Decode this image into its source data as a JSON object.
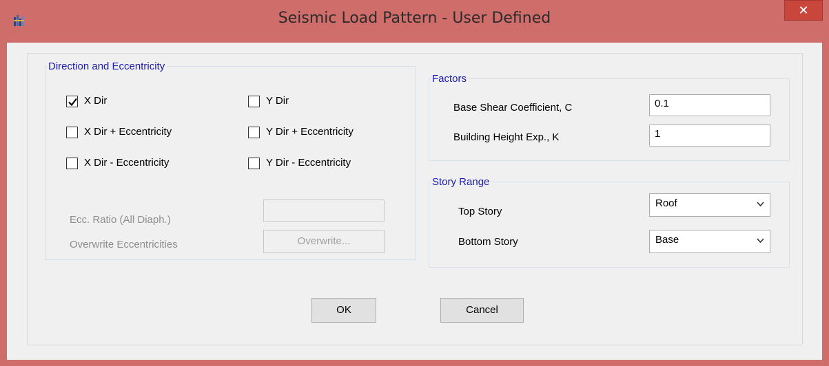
{
  "window": {
    "title": "Seismic Load Pattern - User Defined",
    "close_glyph": "✕",
    "accent": "#cf6d6b"
  },
  "direction_group": {
    "legend": "Direction and Eccentricity",
    "options": [
      {
        "label": "X Dir",
        "checked": true
      },
      {
        "label": "X Dir + Eccentricity",
        "checked": false
      },
      {
        "label": "X Dir - Eccentricity",
        "checked": false
      },
      {
        "label": "Y Dir",
        "checked": false
      },
      {
        "label": "Y Dir + Eccentricity",
        "checked": false
      },
      {
        "label": "Y Dir - Eccentricity",
        "checked": false
      }
    ],
    "ecc_ratio_label": "Ecc. Ratio (All Diaph.)",
    "ecc_ratio_value": "",
    "overwrite_label": "Overwrite Eccentricities",
    "overwrite_button": "Overwrite..."
  },
  "factors_group": {
    "legend": "Factors",
    "base_shear_label": "Base Shear Coefficient, C",
    "base_shear_value": "0.1",
    "height_exp_label": "Building Height Exp., K",
    "height_exp_value": "1"
  },
  "story_group": {
    "legend": "Story Range",
    "top_label": "Top Story",
    "top_value": "Roof",
    "bottom_label": "Bottom Story",
    "bottom_value": "Base"
  },
  "buttons": {
    "ok": "OK",
    "cancel": "Cancel"
  }
}
